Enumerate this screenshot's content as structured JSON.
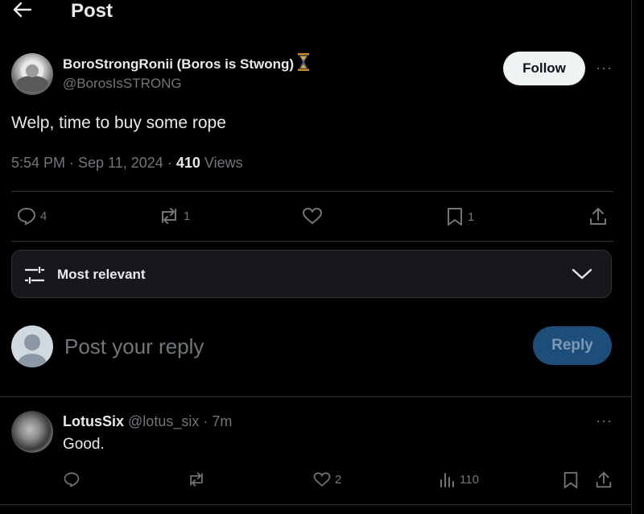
{
  "header": {
    "title": "Post"
  },
  "post": {
    "author_name": "BoroStrongRonii (Boros is Stwong)",
    "author_handle": "@BorosIsSTRONG",
    "follow_label": "Follow",
    "more_label": "···",
    "text": "Welp, time to buy some rope",
    "timestamp": "5:54 PM · Sep 11, 2024",
    "separator": "·",
    "views_count": "410",
    "views_label": "Views",
    "actions": {
      "replies": "4",
      "reposts": "1",
      "likes": "",
      "bookmarks": "1"
    }
  },
  "sort": {
    "label": "Most relevant"
  },
  "composer": {
    "placeholder": "Post your reply",
    "reply_label": "Reply"
  },
  "reply": {
    "name": "LotusSix",
    "handle_time": "@lotus_six · 7m",
    "text": "Good.",
    "more_label": "···",
    "actions": {
      "replies": "",
      "reposts": "",
      "likes": "2",
      "views": "110"
    }
  },
  "colors": {
    "background": "#000000",
    "text": "#e7e9ea",
    "muted": "#71767b",
    "border": "#2f3336",
    "reply_button": "#1d4e7a",
    "hourglass": "#e8a33d"
  }
}
